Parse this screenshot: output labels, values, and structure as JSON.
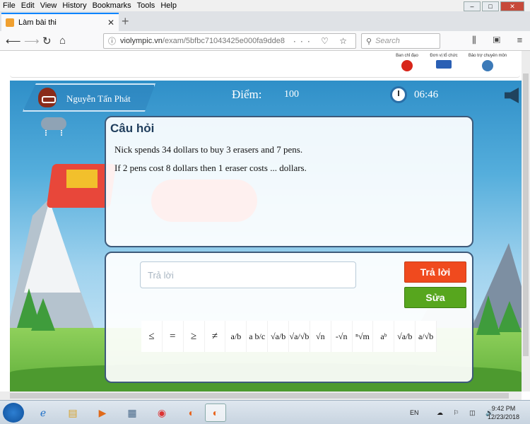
{
  "menubar": {
    "items": [
      "File",
      "Edit",
      "View",
      "History",
      "Bookmarks",
      "Tools",
      "Help"
    ]
  },
  "tab": {
    "title": "Làm bài thi"
  },
  "nav": {
    "url_host": "violympic.vn",
    "url_path": "/exam/5bfbc71043425e000fa9dde8",
    "search_placeholder": "Search"
  },
  "sponsors": [
    {
      "label": "Ban chỉ đạo",
      "color": "#d8261a"
    },
    {
      "label": "Đơn vị tổ chức",
      "color": "#2a5fb4"
    },
    {
      "label": "Bảo trợ chuyên môn",
      "color": "#3c7ab8"
    }
  ],
  "game": {
    "player_name": "Nguyễn Tấn Phát",
    "score_label": "Điểm:",
    "score_value": "100",
    "time_value": "06:46"
  },
  "question": {
    "title": "Câu hỏi",
    "line1": "Nick spends 34 dollars to buy 3 erasers and 7 pens.",
    "line2": "If 2 pens cost 8 dollars then 1 eraser costs ... dollars."
  },
  "answer": {
    "placeholder": "Trả lời",
    "submit_label": "Trả lời",
    "edit_label": "Sửa"
  },
  "math_keys": [
    "≤",
    "=",
    "≥",
    "≠",
    "a/b",
    "a b/c",
    "√a/b",
    "√a/√b",
    "√n",
    "-√n",
    "ⁿ√m",
    "aᵇ",
    "√a/b",
    "a/√b"
  ],
  "taskbar": {
    "lang": "EN",
    "time": "9:42 PM",
    "date": "12/23/2018"
  }
}
